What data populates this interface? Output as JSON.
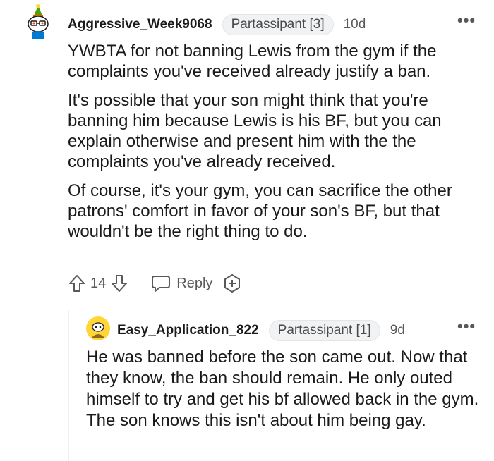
{
  "comments": [
    {
      "username": "Aggressive_Week9068",
      "flair": "Partassipant [3]",
      "age": "10d",
      "paragraphs": [
        "YWBTA for not banning Lewis from the gym if the complaints you've received already justify a ban.",
        "It's possible that your son might think that you're banning him because Lewis is his BF, but you can explain otherwise and present him with the the complaints you've already received.",
        "Of course, it's your gym, you can sacrifice the other patrons' comfort in favor of your son's BF, but that wouldn't be the right thing to do."
      ],
      "votes": "14",
      "reply_label": "Reply"
    },
    {
      "username": "Easy_Application_822",
      "flair": "Partassipant [1]",
      "age": "9d",
      "paragraphs": [
        "He was banned before the son came out. Now that they know, the ban should remain. He only outed himself to try and get his bf allowed back in the gym. The son knows this isn't about him being gay."
      ]
    }
  ],
  "icons": {
    "more": "more-options-icon",
    "upvote": "upvote-icon",
    "downvote": "downvote-icon",
    "reply": "reply-icon",
    "award": "award-icon"
  },
  "colors": {
    "text": "#1a1a1b",
    "meta": "#57595b",
    "flair_bg": "#f1f2f3"
  }
}
